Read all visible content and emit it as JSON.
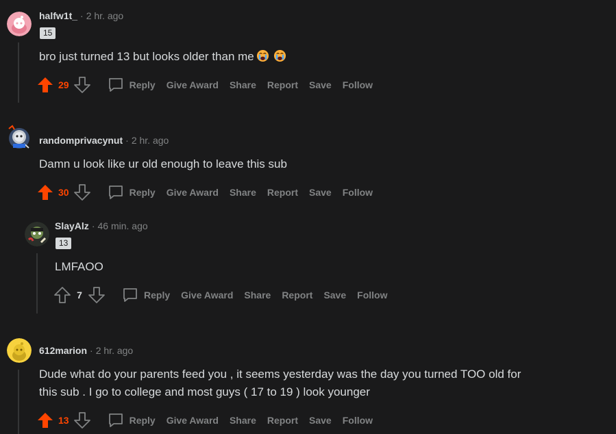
{
  "comments": [
    {
      "username": "halfw1t_",
      "time": "2 hr. ago",
      "flair": "15",
      "text": "bro just turned 13 but looks older than me",
      "score": "29",
      "vote_state": "up",
      "actions": {
        "reply": "Reply",
        "award": "Give Award",
        "share": "Share",
        "report": "Report",
        "save": "Save",
        "follow": "Follow"
      }
    },
    {
      "username": "randomprivacynut",
      "time": "2 hr. ago",
      "text": "Damn u look like ur old enough to leave this sub",
      "score": "30",
      "vote_state": "up",
      "actions": {
        "reply": "Reply",
        "award": "Give Award",
        "share": "Share",
        "report": "Report",
        "save": "Save",
        "follow": "Follow"
      }
    },
    {
      "username": "SlayAlz",
      "time": "46 min. ago",
      "flair": "13",
      "text": "LMFAOO",
      "score": "7",
      "vote_state": "none",
      "actions": {
        "reply": "Reply",
        "award": "Give Award",
        "share": "Share",
        "report": "Report",
        "save": "Save",
        "follow": "Follow"
      }
    },
    {
      "username": "612marion",
      "time": "2 hr. ago",
      "text_line1": "Dude what do your parents feed you , it seems yesterday was the day you turned TOO old for",
      "text_line2": "this sub . I go to college and most guys ( 17 to 19 ) look younger",
      "score": "13",
      "vote_state": "up",
      "actions": {
        "reply": "Reply",
        "award": "Give Award",
        "share": "Share",
        "report": "Report",
        "save": "Save",
        "follow": "Follow"
      }
    }
  ],
  "separator": "·",
  "colors": {
    "upvote": "#ff4500",
    "background": "#1a1a1b",
    "muted": "#818384",
    "text": "#d7dadc"
  }
}
